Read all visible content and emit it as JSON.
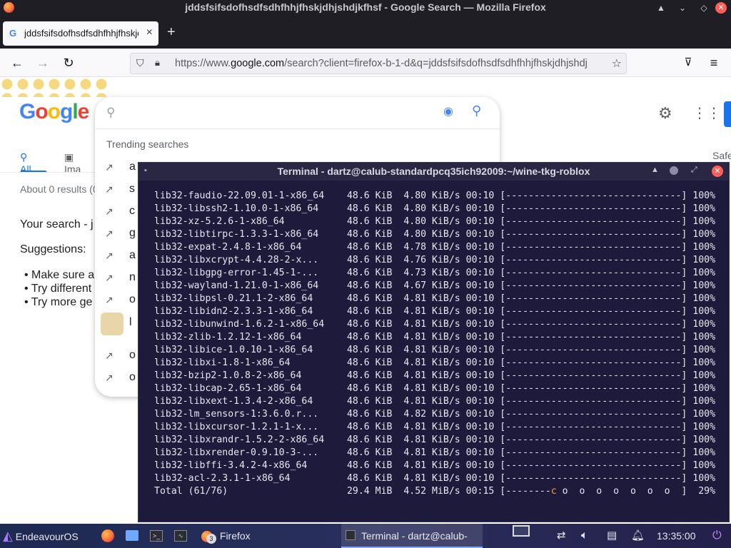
{
  "firefox": {
    "window_title": "jddsfsifsdofhsdfsdhfhhjfhskjdhjshdjkfhsf - Google Search — Mozilla Firefox",
    "tab_label": "jddsfsifsdofhsdfsdhfhhjfhskjdhjshdjkfhsf",
    "url_prefix": "https://www.",
    "url_host": "google.com",
    "url_rest": "/search?client=firefox-b-1-d&q=jddsfsifsdofhsdfsdhfhhjfhskjdhjshdj"
  },
  "google": {
    "logo_letters": [
      {
        "ch": "G",
        "color": "#4285f4"
      },
      {
        "ch": "o",
        "color": "#ea4335"
      },
      {
        "ch": "o",
        "color": "#fbbc05"
      },
      {
        "ch": "g",
        "color": "#4285f4"
      },
      {
        "ch": "l",
        "color": "#34a853"
      },
      {
        "ch": "e",
        "color": "#ea4335"
      }
    ],
    "trending_label": "Trending searches",
    "trending_items": [
      "a",
      "s",
      "c",
      "g",
      "a",
      "n",
      "o",
      "l",
      "o",
      "o"
    ],
    "tabs": {
      "all": "All",
      "images": "Ima"
    },
    "results_count": "About 0 results (0",
    "your_search": "Your search - j",
    "suggestions": "Suggestions:",
    "bullets": [
      "Make sure a",
      "Try different",
      "Try more ge"
    ],
    "safe_label": "Safe"
  },
  "terminal": {
    "title": "Terminal - dartz@calub-standardpcq35ich92009:~/wine-tkg-roblox",
    "lines": [
      "lib32-faudio-22.09.01-1-x86_64    48.6 KiB  4.80 KiB/s 00:10 [-------------------------------] 100%",
      "lib32-libssh2-1.10.0-1-x86_64     48.6 KiB  4.80 KiB/s 00:10 [-------------------------------] 100%",
      "lib32-xz-5.2.6-1-x86_64           48.6 KiB  4.80 KiB/s 00:10 [-------------------------------] 100%",
      "lib32-libtirpc-1.3.3-1-x86_64     48.6 KiB  4.80 KiB/s 00:10 [-------------------------------] 100%",
      "lib32-expat-2.4.8-1-x86_64        48.6 KiB  4.78 KiB/s 00:10 [-------------------------------] 100%",
      "lib32-libxcrypt-4.4.28-2-x...     48.6 KiB  4.76 KiB/s 00:10 [-------------------------------] 100%",
      "lib32-libgpg-error-1.45-1-...     48.6 KiB  4.73 KiB/s 00:10 [-------------------------------] 100%",
      "lib32-wayland-1.21.0-1-x86_64     48.6 KiB  4.67 KiB/s 00:10 [-------------------------------] 100%",
      "lib32-libpsl-0.21.1-2-x86_64      48.6 KiB  4.81 KiB/s 00:10 [-------------------------------] 100%",
      "lib32-libidn2-2.3.3-1-x86_64      48.6 KiB  4.81 KiB/s 00:10 [-------------------------------] 100%",
      "lib32-libunwind-1.6.2-1-x86_64    48.6 KiB  4.81 KiB/s 00:10 [-------------------------------] 100%",
      "lib32-zlib-1.2.12-1-x86_64        48.6 KiB  4.81 KiB/s 00:10 [-------------------------------] 100%",
      "lib32-libice-1.0.10-1-x86_64      48.6 KiB  4.81 KiB/s 00:10 [-------------------------------] 100%",
      "lib32-libxi-1.8-1-x86_64          48.6 KiB  4.81 KiB/s 00:10 [-------------------------------] 100%",
      "lib32-bzip2-1.0.8-2-x86_64        48.6 KiB  4.81 KiB/s 00:10 [-------------------------------] 100%",
      "lib32-libcap-2.65-1-x86_64        48.6 KiB  4.81 KiB/s 00:10 [-------------------------------] 100%",
      "lib32-libxext-1.3.4-2-x86_64      48.6 KiB  4.81 KiB/s 00:10 [-------------------------------] 100%",
      "lib32-lm_sensors-1:3.6.0.r...     48.6 KiB  4.82 KiB/s 00:10 [-------------------------------] 100%",
      "lib32-libxcursor-1.2.1-1-x...     48.6 KiB  4.81 KiB/s 00:10 [-------------------------------] 100%",
      "lib32-libxrandr-1.5.2-2-x86_64    48.6 KiB  4.81 KiB/s 00:10 [-------------------------------] 100%",
      "lib32-libxrender-0.9.10-3-...     48.6 KiB  4.81 KiB/s 00:10 [-------------------------------] 100%",
      "lib32-libffi-3.4.2-4-x86_64       48.6 KiB  4.81 KiB/s 00:10 [-------------------------------] 100%",
      "lib32-acl-2.3.1-1-x86_64          48.6 KiB  4.81 KiB/s 00:10 [-------------------------------] 100%"
    ],
    "total_prefix": "Total (61/76)                     29.4 MiB  4.52 MiB/s 00:15 [--------",
    "total_pacman": "c",
    "total_suffix": " o  o  o  o  o  o  o  ]  29%"
  },
  "taskbar": {
    "start_label": "EndeavourOS",
    "firefox_label": "Firefox",
    "firefox_count": "3",
    "active_window_label": "Terminal - dartz@calub-st...",
    "clock": "13:35:00"
  }
}
